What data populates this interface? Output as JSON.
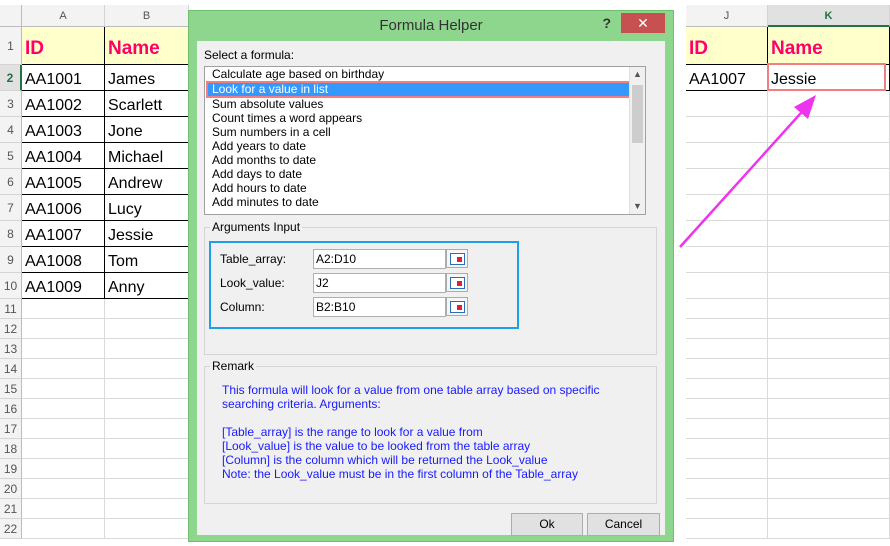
{
  "spreadsheet": {
    "columns": [
      "A",
      "B",
      "J",
      "K"
    ],
    "rows": [
      "1",
      "2",
      "3",
      "4",
      "5",
      "6",
      "7",
      "8",
      "9",
      "10",
      "11",
      "12",
      "13",
      "14",
      "15",
      "16",
      "17",
      "18",
      "19",
      "20",
      "21",
      "22"
    ],
    "headers": {
      "id": "ID",
      "name": "Name"
    },
    "data": [
      {
        "id": "AA1001",
        "name": "James"
      },
      {
        "id": "AA1002",
        "name": "Scarlett"
      },
      {
        "id": "AA1003",
        "name": "Jone"
      },
      {
        "id": "AA1004",
        "name": "Michael"
      },
      {
        "id": "AA1005",
        "name": "Andrew"
      },
      {
        "id": "AA1006",
        "name": "Lucy"
      },
      {
        "id": "AA1007",
        "name": "Jessie"
      },
      {
        "id": "AA1008",
        "name": "Tom"
      },
      {
        "id": "AA1009",
        "name": "Anny"
      }
    ],
    "result": {
      "id_header": "ID",
      "name_header": "Name",
      "id": "AA1007",
      "name": "Jessie"
    }
  },
  "dialog": {
    "title": "Formula Helper",
    "help": "?",
    "close": "✕",
    "select_label": "Select a formula:",
    "formulas": [
      "Calculate age based on birthday",
      "Look for a value in list",
      "Sum absolute values",
      "Count times a word appears",
      "Sum numbers in a cell",
      "Add years to date",
      "Add months to date",
      "Add days to date",
      "Add hours to date",
      "Add minutes to date"
    ],
    "selected_index": 1,
    "arguments_title": "Arguments Input",
    "arguments": [
      {
        "label": "Table_array:",
        "value": "A2:D10"
      },
      {
        "label": "Look_value:",
        "value": "J2"
      },
      {
        "label": "Column:",
        "value": "B2:B10"
      }
    ],
    "remark_title": "Remark",
    "remark_lines": [
      "This formula will look for a value from one table array based on specific",
      "searching criteria. Arguments:",
      "",
      "[Table_array] is the range to look for a value from",
      "[Look_value] is the value to be looked from the table array",
      "[Column] is the column which will be returned the Look_value",
      "Note: the Look_value must be in the first column of the Table_array"
    ],
    "ok_label": "Ok",
    "cancel_label": "Cancel"
  },
  "colors": {
    "accent_pink": "#ff0066",
    "highlight_blue": "#1ea0e6",
    "highlight_red": "#f08080",
    "arrow": "#ee33ee",
    "dialog_frame": "#8ed68e"
  }
}
